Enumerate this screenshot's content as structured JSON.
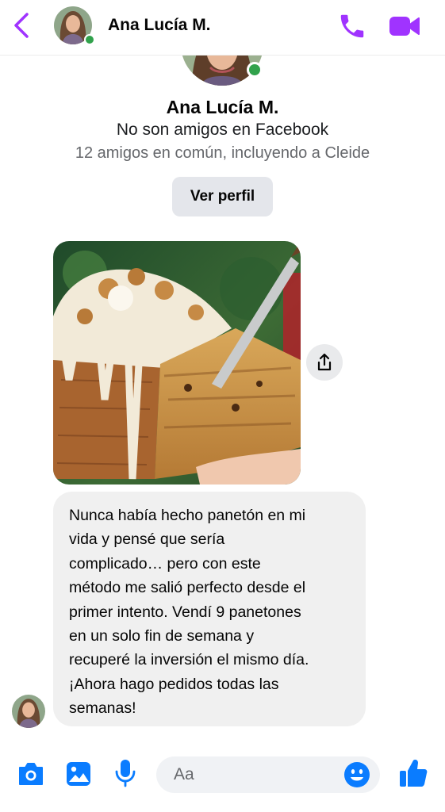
{
  "header": {
    "name": "Ana Lucía M.",
    "icons": [
      "back-chevron-icon",
      "phone-icon",
      "video-camera-icon"
    ]
  },
  "profile": {
    "name": "Ana Lucía M.",
    "relationship": "No son amigos en Facebook",
    "mutual": "12 amigos en común, incluyendo a Cleide",
    "view_profile_label": "Ver perfil",
    "online": true
  },
  "messages": [
    {
      "type": "image",
      "alt": "panetón"
    },
    {
      "type": "text",
      "lines": [
        "Nunca había hecho panetón en mi",
        "vida y pensé que sería",
        "complicado… pero con este",
        "método me salió perfecto desde el",
        "primer intento. Vendí 9 panetones",
        "en un solo fin de semana y",
        "recuperé la inversión el mismo día.",
        "¡Ahora hago pedidos todas las",
        "semanas!"
      ]
    }
  ],
  "composer": {
    "placeholder": "Aa",
    "icons": [
      "camera-icon",
      "gallery-icon",
      "microphone-icon",
      "emoji-icon",
      "thumbs-up-icon"
    ]
  },
  "colors": {
    "accent_purple": "#a033ff",
    "accent_blue": "#0a7cff",
    "online_green": "#31a24c",
    "bubble_gray": "#f0f0f0",
    "button_gray": "#e4e6eb"
  }
}
